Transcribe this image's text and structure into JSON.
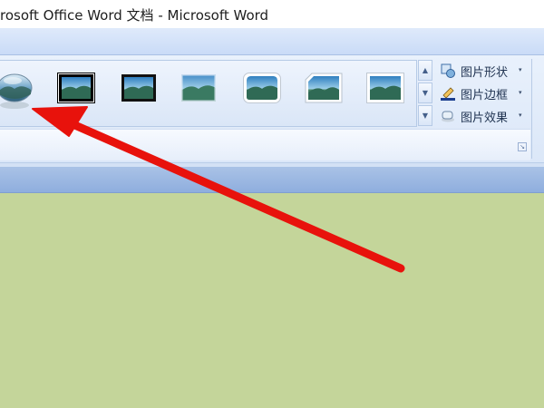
{
  "window": {
    "title": "rosoft Office Word 文档 - Microsoft Word"
  },
  "picture_styles": {
    "items": [
      {
        "name": "oval-shadow-style"
      },
      {
        "name": "thick-black-frame-style"
      },
      {
        "name": "black-shadow-frame-style"
      },
      {
        "name": "soft-edge-style"
      },
      {
        "name": "rounded-white-frame-style"
      },
      {
        "name": "snip-corner-style"
      },
      {
        "name": "simple-white-frame-style"
      }
    ],
    "scroll": {
      "up_icon": "▲",
      "down_icon": "▼",
      "more_icon": "▼"
    }
  },
  "picture_tools": {
    "shape_label": "图片形状",
    "border_label": "图片边框",
    "effects_label": "图片效果",
    "dropdown_glyph": "▾"
  },
  "group": {
    "launcher_glyph": "↘"
  },
  "colors": {
    "document_bg": "#c4d59a",
    "ribbon_bg": "#dbe7f8",
    "arrow": "#e8120c"
  }
}
